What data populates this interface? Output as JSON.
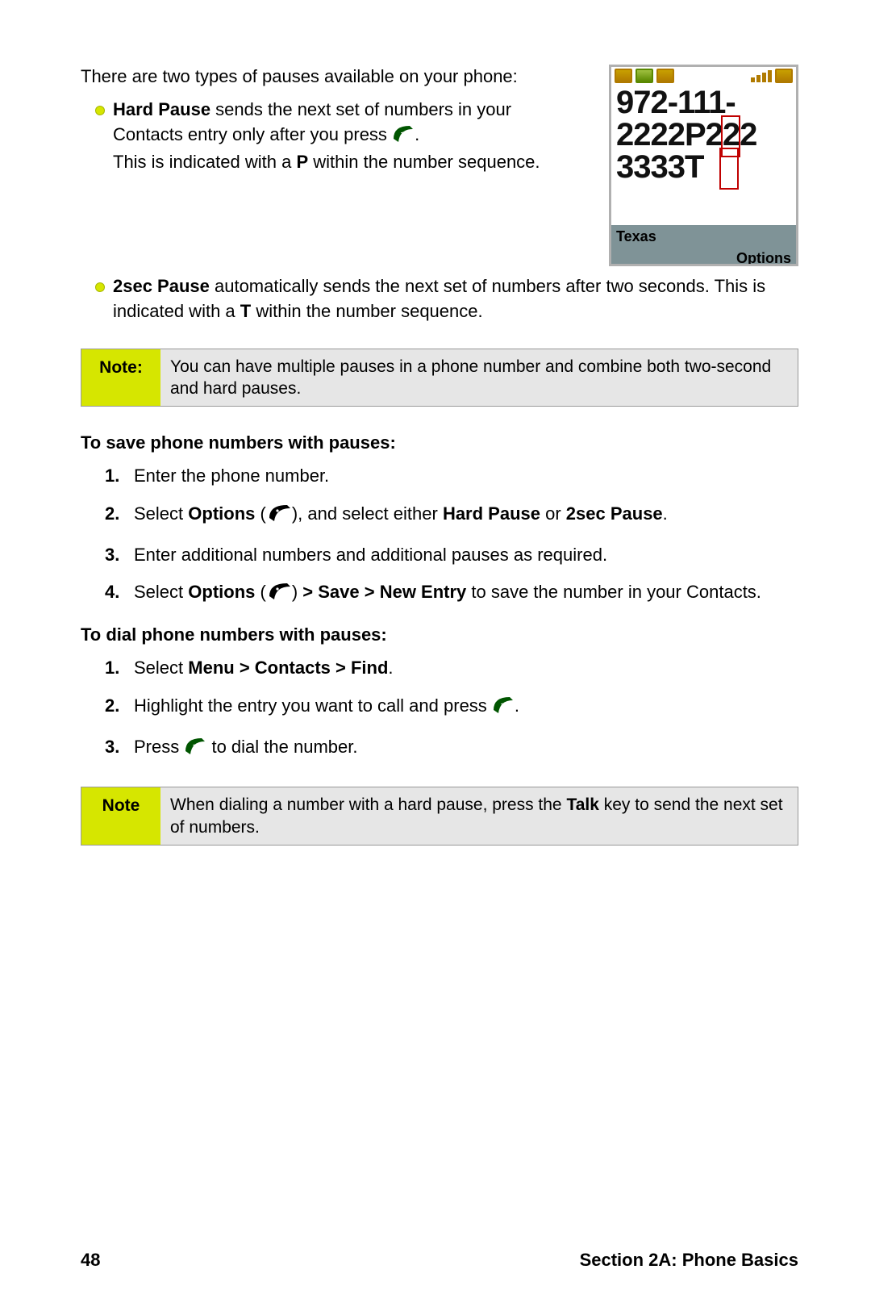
{
  "intro": "There are two types of pauses available on your phone:",
  "bullets": {
    "hard": {
      "bold": "Hard Pause",
      "text1": " sends the next set of numbers in your Contacts entry only after you press ",
      "text2": ".",
      "text3": "This is indicated with a ",
      "letter": "P",
      "text4": " within the number sequence."
    },
    "twosec": {
      "bold": "2sec Pause",
      "text1": " automatically sends the next set of numbers after two seconds. This is indicated with a ",
      "letter": "T",
      "text2": " within the number sequence."
    }
  },
  "phone": {
    "line1": "972-111-",
    "line2a": "2222P",
    "line2b": "222",
    "line3": "3333T",
    "location": "Texas",
    "options": "Options"
  },
  "note1": {
    "label": "Note:",
    "body": "You can have multiple pauses in a phone number and combine both two-second and hard pauses."
  },
  "save": {
    "heading": "To save phone numbers with pauses:",
    "s1": "Enter the phone number.",
    "s2a": "Select ",
    "s2b": "Options",
    "s2c": " (",
    "s2d": "), and select either ",
    "s2e": "Hard Pause",
    "s2f": " or ",
    "s2g": "2sec Pause",
    "s2h": ".",
    "s3": "Enter additional numbers and additional pauses as required.",
    "s4a": "Select ",
    "s4b": "Options",
    "s4c": " (",
    "s4d": ") ",
    "s4e": "> Save > New Entry",
    "s4f": " to save the number in your Contacts."
  },
  "dial": {
    "heading": "To dial phone numbers with pauses:",
    "s1a": "Select ",
    "s1b": "Menu > Contacts > Find",
    "s1c": ".",
    "s2a": "Highlight the entry you want to call and press ",
    "s2b": ".",
    "s3a": "Press ",
    "s3b": " to dial the number."
  },
  "note2": {
    "label": "Note",
    "body1": "When dialing a number with a hard pause, press the ",
    "body_bold": "Talk",
    "body2": " key to send the next set of numbers."
  },
  "footer": {
    "page": "48",
    "section": "Section 2A: Phone Basics"
  }
}
